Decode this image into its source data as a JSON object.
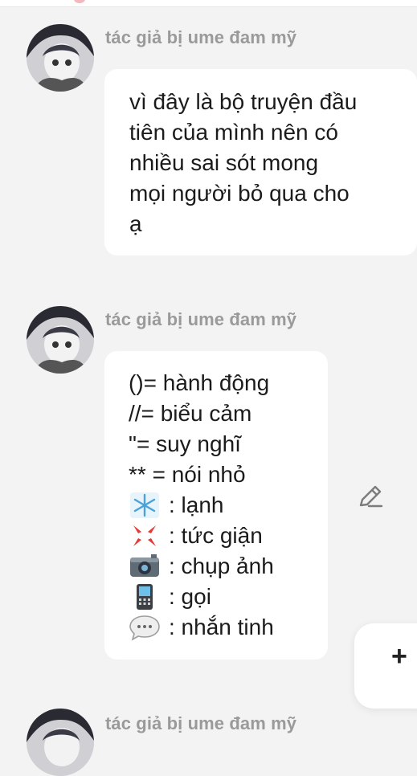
{
  "messages": [
    {
      "author": "tác giả bị ume đam mỹ",
      "lines": [
        "vì đây là bộ truyện đầu",
        "tiên của mình nên có",
        "nhiều sai sót mong",
        "mọi người bỏ qua cho",
        "ạ"
      ]
    },
    {
      "author": "tác giả bị ume đam mỹ",
      "lines": [
        "()= hành động",
        "//= biểu cảm",
        "\"= suy nghĩ",
        "** = nói nhỏ"
      ],
      "legend": [
        {
          "icon": "snowflake-icon",
          "label": ": lạnh"
        },
        {
          "icon": "anger-icon",
          "label": ": tức giận"
        },
        {
          "icon": "camera-icon",
          "label": ": chụp ảnh"
        },
        {
          "icon": "mobile-phone-icon",
          "label": ": gọi"
        },
        {
          "icon": "speech-bubble-icon",
          "label": ": nhắn tinh"
        }
      ]
    },
    {
      "author": "tác giả bị ume đam mỹ"
    }
  ],
  "controls": {
    "edit_icon": "pencil-icon",
    "fab_label": "+"
  },
  "colors": {
    "background": "#f3f3f3",
    "bubble": "#ffffff",
    "author_text": "#9a9a9a",
    "body_text": "#1b1b1b"
  }
}
